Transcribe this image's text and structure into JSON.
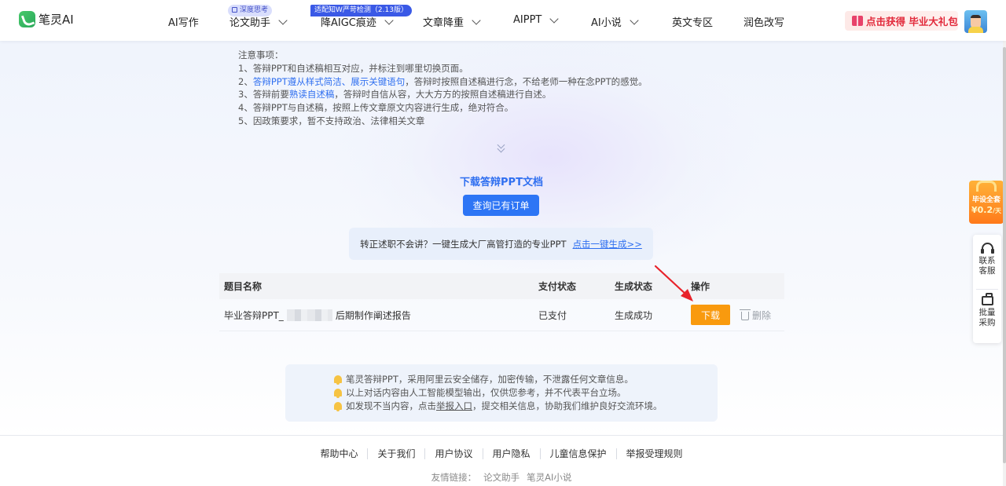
{
  "header": {
    "logo_text": "笔灵AI",
    "nav": [
      {
        "label": "AI写作",
        "has_dropdown": false
      },
      {
        "label": "论文助手",
        "has_dropdown": true,
        "badge": "深度思考"
      },
      {
        "label": "降AIGC痕迹",
        "has_dropdown": true,
        "badge": "适配知W严苛检测（2.13版）"
      },
      {
        "label": "文章降重",
        "has_dropdown": true
      },
      {
        "label": "AIPPT",
        "has_dropdown": true
      },
      {
        "label": "AI小说",
        "has_dropdown": true
      },
      {
        "label": "英文专区",
        "has_dropdown": false
      },
      {
        "label": "润色改写",
        "has_dropdown": false
      }
    ],
    "gift_button": "点击获得 毕业大礼包"
  },
  "notes": {
    "title": "注意事项：",
    "items": [
      {
        "prefix": "1、",
        "highlight": "",
        "text": "答辩PPT和自述稿相互对应，并标注到哪里切换页面。"
      },
      {
        "prefix": "2、",
        "highlight": "答辩PPT遵从样式简洁、展示关键语句",
        "text": "，答辩时按照自述稿进行念，不给老师一种在念PPT的感觉。"
      },
      {
        "prefix": "3、",
        "pre": "答辩前要",
        "highlight": "熟读自述稿",
        "text": "，答辩时自信从容，大大方方的按照自述稿进行自述。"
      },
      {
        "prefix": "4、",
        "highlight": "",
        "text": "答辩PPT与自述稿，按照上传文章原文内容进行生成，绝对符合。"
      },
      {
        "prefix": "5、",
        "highlight": "",
        "text": "因政策要求，暂不支持政治、法律相关文章"
      }
    ]
  },
  "download": {
    "title": "下载答辩PPT文档",
    "query_button": "查询已有订单"
  },
  "promo": {
    "text": "转正述职不会讲？一键生成大厂高管打造的专业PPT",
    "link": "点击一键生成>>"
  },
  "table": {
    "headers": [
      "题目名称",
      "支付状态",
      "生成状态",
      "操作"
    ],
    "rows": [
      {
        "title_prefix": "毕业答辩PPT_",
        "title_suffix": "后期制作阐述报告",
        "pay_status": "已支付",
        "gen_status": "生成成功",
        "download": "下载",
        "delete": "删除"
      }
    ]
  },
  "disclaimer": {
    "lines": [
      {
        "pre": "笔灵答辩PPT，采用阿里云安全储存，加密传输，不泄露任何文章信息。",
        "link": "",
        "post": ""
      },
      {
        "pre": "以上对话内容由人工智能模型输出，仅供您参考，并不代表平台立场。",
        "link": "",
        "post": ""
      },
      {
        "pre": "如发现不当内容，点击",
        "link": "举报入口",
        "post": "，提交相关信息，协助我们维护良好交流环境。"
      }
    ]
  },
  "footer": {
    "links": [
      "帮助中心",
      "关于我们",
      "用户协议",
      "用户隐私",
      "儿童信息保护",
      "举报受理规则"
    ],
    "friends_label": "友情链接：",
    "friends": [
      "论文助手",
      "笔灵AI小说"
    ]
  },
  "side": {
    "gift_line1": "毕设全套",
    "gift_line2": "¥0.2",
    "gift_unit": "/天",
    "contact": [
      "联系",
      "客服"
    ],
    "bulk": [
      "批量",
      "采购"
    ]
  },
  "colors": {
    "accent": "#2d75f5",
    "download": "#f99a0e",
    "arrow": "#e8222a"
  }
}
